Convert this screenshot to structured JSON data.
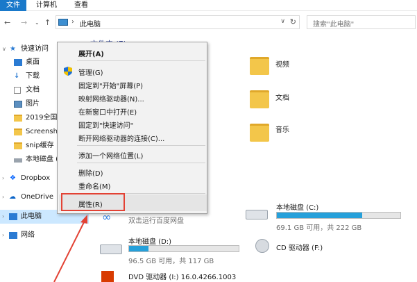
{
  "ribbon": {
    "tabs": [
      "文件",
      "计算机",
      "查看"
    ]
  },
  "address": {
    "crumb": "此电脑",
    "separator": "›"
  },
  "search": {
    "placeholder": "搜索\"此电脑\""
  },
  "nav": {
    "quick_access": "快速访问",
    "items": [
      "桌面",
      "下载",
      "文档",
      "图片",
      "2019全国:",
      "Screensho",
      "snip缓存",
      "本地磁盘 ("
    ],
    "dropbox": "Dropbox",
    "onedrive": "OneDrive",
    "this_pc": "此电脑",
    "network": "网络"
  },
  "main": {
    "group_header": "文件夹 (7)",
    "folders": [
      "视频",
      "文档",
      "音乐"
    ],
    "drives": [
      {
        "name": "本地磁盘 (C:)",
        "sub": "69.1 GB 可用，共 222 GB",
        "used_fraction": 0.69
      },
      {
        "name": "本地磁盘 (D:)",
        "sub": "96.5 GB 可用，共 117 GB",
        "used_fraction": 0.18
      },
      {
        "name": "CD 驱动器 (F:)"
      },
      {
        "name": "DVD 驱动器 (I:) 16.0.4266.1003"
      }
    ],
    "baidu_sub": "双击运行百度网盘"
  },
  "context_menu": {
    "items": {
      "expand": "展开(A)",
      "manage": "管理(G)",
      "pin_start": "固定到\"开始\"屏幕(P)",
      "map_drive": "映射网络驱动器(N)...",
      "open_new_window": "在新窗口中打开(E)",
      "pin_quick": "固定到\"快速访问\"",
      "disconnect": "断开网络驱动器的连接(C)...",
      "add_location": "添加一个网络位置(L)",
      "delete": "删除(D)",
      "rename": "重命名(M)",
      "properties": "属性(R)"
    }
  },
  "colors": {
    "accent": "#1979ca",
    "highlight_box": "#e34234",
    "selection": "#cce8ff"
  }
}
